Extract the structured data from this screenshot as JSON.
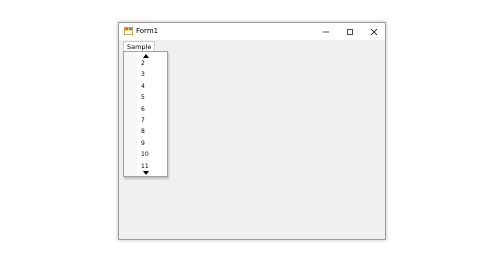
{
  "window": {
    "title": "Form1",
    "minimize_icon": "minimize-icon",
    "maximize_icon": "maximize-icon",
    "close_icon": "close-icon"
  },
  "menu": {
    "items": [
      {
        "label": "Sample"
      }
    ]
  },
  "dropdown": {
    "scroll_up_icon": "scroll-up-arrow-icon",
    "scroll_down_icon": "scroll-down-arrow-icon",
    "items": [
      "2",
      "3",
      "4",
      "5",
      "6",
      "7",
      "8",
      "9",
      "10",
      "11"
    ]
  }
}
